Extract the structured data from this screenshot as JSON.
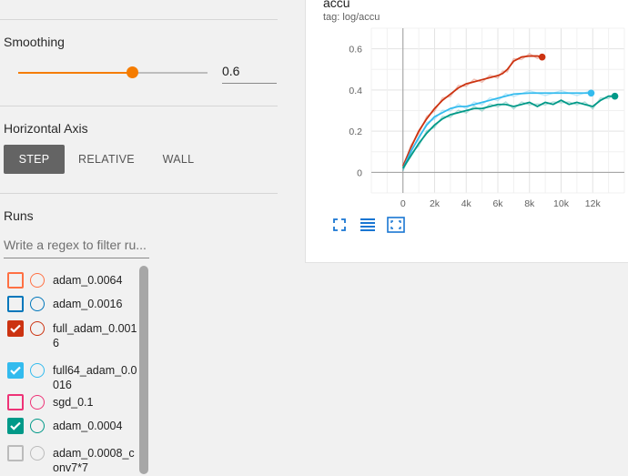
{
  "sidebar": {
    "smoothing": {
      "title": "Smoothing",
      "value": "0.6",
      "fraction": 0.6
    },
    "horizontal_axis": {
      "title": "Horizontal Axis",
      "options": [
        {
          "label": "STEP",
          "active": true
        },
        {
          "label": "RELATIVE",
          "active": false
        },
        {
          "label": "WALL",
          "active": false
        }
      ]
    },
    "runs": {
      "title": "Runs",
      "filter_placeholder": "Write a regex to filter ru...",
      "items": [
        {
          "label": "adam_0.0064",
          "color": "#ff7043",
          "checked": false
        },
        {
          "label": "adam_0.0016",
          "color": "#0077bb",
          "checked": false
        },
        {
          "label": "full_adam_0.0016",
          "color": "#cc3311",
          "checked": true
        },
        {
          "label": "full64_adam_0.0016",
          "color": "#33bbee",
          "checked": true
        },
        {
          "label": "sgd_0.1",
          "color": "#ee3377",
          "checked": false
        },
        {
          "label": "adam_0.0004",
          "color": "#009988",
          "checked": true
        },
        {
          "label": "adam_0.0008_conv7*7",
          "color": "#bbbbbb",
          "checked": false
        }
      ]
    }
  },
  "card": {
    "title": "accu",
    "tag": "tag: log/accu",
    "icons": [
      "fullscreen-icon",
      "data-list-icon",
      "fit-domain-icon"
    ],
    "accent_color": "#1976d2"
  },
  "chart_data": {
    "type": "line",
    "title": "accu",
    "xlabel": "",
    "ylabel": "",
    "xlim": [
      -2000,
      14000
    ],
    "ylim": [
      -0.1,
      0.7
    ],
    "x_ticks": [
      0,
      2000,
      4000,
      6000,
      8000,
      10000,
      12000
    ],
    "x_tick_labels": [
      "0",
      "2k",
      "4k",
      "6k",
      "8k",
      "10k",
      "12k"
    ],
    "y_ticks": [
      0,
      0.2,
      0.4,
      0.6
    ],
    "y_tick_labels": [
      "0",
      "0.2",
      "0.4",
      "0.6"
    ],
    "grid": true,
    "series": [
      {
        "color": "#cc3311",
        "x": [
          0,
          500,
          1000,
          1500,
          2000,
          2500,
          3000,
          3500,
          4000,
          4500,
          5000,
          5500,
          6000,
          6300,
          6600,
          7000,
          7500,
          8000,
          8500,
          8800
        ],
        "y": [
          0.03,
          0.12,
          0.2,
          0.26,
          0.31,
          0.35,
          0.38,
          0.41,
          0.43,
          0.44,
          0.45,
          0.46,
          0.47,
          0.48,
          0.5,
          0.54,
          0.56,
          0.565,
          0.565,
          0.56
        ]
      },
      {
        "color": "#33bbee",
        "x": [
          0,
          500,
          1000,
          1500,
          2000,
          2500,
          3000,
          3500,
          4000,
          4500,
          5000,
          5500,
          6000,
          6500,
          7000,
          8000,
          9000,
          10000,
          11000,
          11900
        ],
        "y": [
          0.02,
          0.1,
          0.17,
          0.23,
          0.27,
          0.29,
          0.31,
          0.32,
          0.32,
          0.33,
          0.34,
          0.35,
          0.36,
          0.37,
          0.38,
          0.385,
          0.385,
          0.385,
          0.385,
          0.385
        ]
      },
      {
        "color": "#009988",
        "x": [
          0,
          500,
          1000,
          1500,
          2000,
          2500,
          3000,
          3500,
          4000,
          4500,
          5000,
          5500,
          6000,
          6500,
          7000,
          7500,
          8000,
          8500,
          9000,
          9500,
          10000,
          10500,
          11000,
          11500,
          12000,
          12500,
          13000,
          13400
        ],
        "y": [
          0.02,
          0.08,
          0.14,
          0.19,
          0.23,
          0.26,
          0.28,
          0.29,
          0.3,
          0.31,
          0.31,
          0.32,
          0.33,
          0.33,
          0.32,
          0.33,
          0.34,
          0.32,
          0.34,
          0.33,
          0.35,
          0.33,
          0.34,
          0.33,
          0.32,
          0.35,
          0.37,
          0.37
        ]
      }
    ]
  }
}
